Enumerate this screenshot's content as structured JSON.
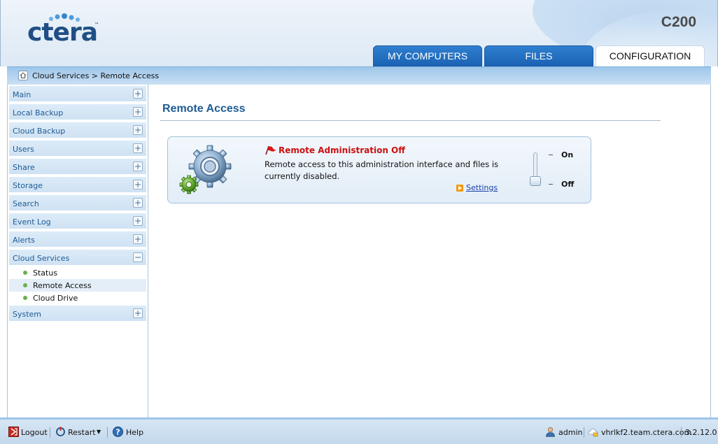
{
  "header": {
    "logo_text": "ctera",
    "logo_tm": "™",
    "model": "C200"
  },
  "tabs": [
    {
      "label": "MY COMPUTERS"
    },
    {
      "label": "FILES"
    },
    {
      "label": "CONFIGURATION",
      "active": true
    }
  ],
  "breadcrumb": "Cloud Services > Remote Access",
  "sidebar": {
    "items": [
      {
        "label": "Main",
        "toggle": "+"
      },
      {
        "label": "Local Backup",
        "toggle": "+"
      },
      {
        "label": "Cloud Backup",
        "toggle": "+"
      },
      {
        "label": "Users",
        "toggle": "+"
      },
      {
        "label": "Share",
        "toggle": "+"
      },
      {
        "label": "Storage",
        "toggle": "+"
      },
      {
        "label": "Search",
        "toggle": "+"
      },
      {
        "label": "Event Log",
        "toggle": "+"
      },
      {
        "label": "Alerts",
        "toggle": "+"
      },
      {
        "label": "Cloud Services",
        "toggle": "−"
      },
      {
        "label": "System",
        "toggle": "+"
      }
    ],
    "cloud_services_children": [
      {
        "label": "Status"
      },
      {
        "label": "Remote Access",
        "active": true
      },
      {
        "label": "Cloud Drive"
      }
    ]
  },
  "main": {
    "title": "Remote Access",
    "panel": {
      "status_title": "Remote Administration Off",
      "description": " Remote access to this administration interface and files is currently disabled.",
      "settings_link": "Settings",
      "toggle_on_label": "On",
      "toggle_off_label": "Off",
      "toggle_state": "Off"
    }
  },
  "footer": {
    "logout": "Logout",
    "restart": "Restart",
    "help": "Help",
    "user": "admin",
    "host": "vhrlkf2.team.ctera.com",
    "version": "3.2.12.0"
  },
  "colors": {
    "tab_blue": "#1b63b4",
    "title_blue": "#1e5b95",
    "alert_red": "#cc1010",
    "link_blue": "#1a3fa8"
  }
}
